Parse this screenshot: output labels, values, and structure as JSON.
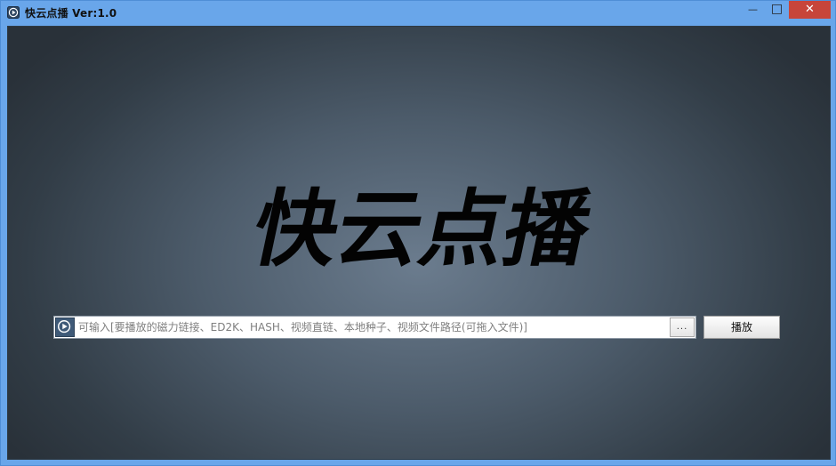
{
  "window": {
    "title": "快云点播 Ver:1.0",
    "min_glyph": "—",
    "max_glyph": "□",
    "close_glyph": "✕"
  },
  "main": {
    "logo_text": "快云点播",
    "input_placeholder": "可输入[要播放的磁力链接、ED2K、HASH、视频直链、本地种子、视频文件路径(可拖入文件)]",
    "input_value": "",
    "browse_label": "...",
    "play_label": "播放"
  },
  "colors": {
    "title_bar": "#69a6ea",
    "close_button": "#c7453a",
    "background_center": "#6b7c8e",
    "background_edge": "#293139"
  },
  "icons": {
    "app": "play-circle-icon",
    "input": "play-circle-icon"
  }
}
